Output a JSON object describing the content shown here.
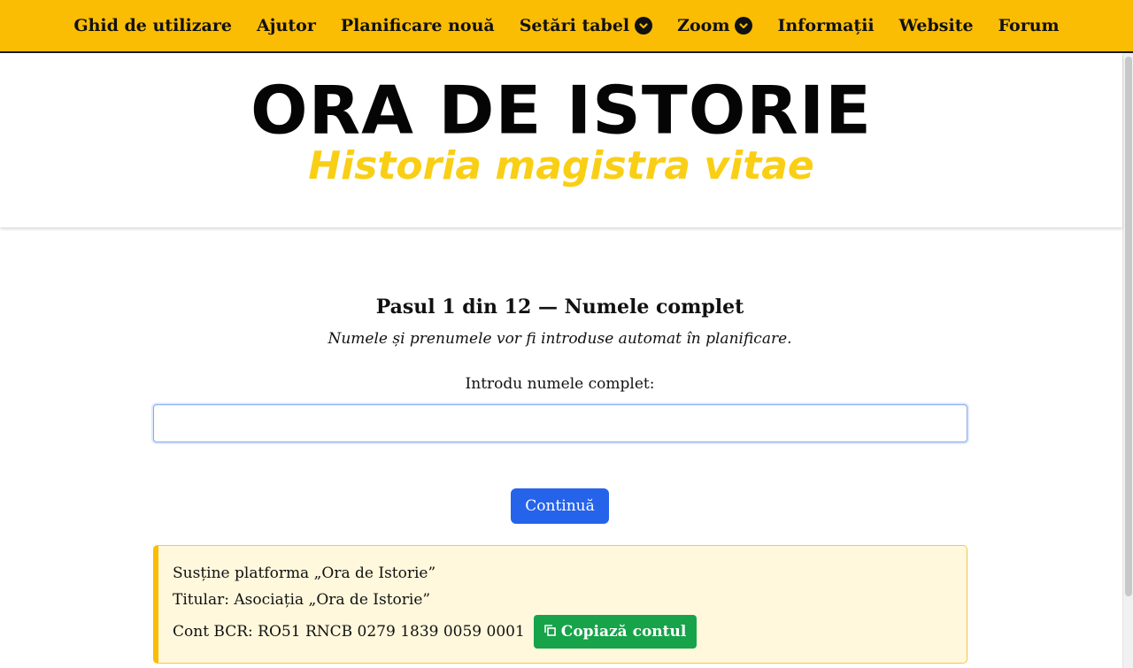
{
  "nav": {
    "items": [
      {
        "label": "Ghid de utilizare",
        "dropdown": false
      },
      {
        "label": "Ajutor",
        "dropdown": false
      },
      {
        "label": "Planificare nouă",
        "dropdown": false
      },
      {
        "label": "Setări tabel",
        "dropdown": true
      },
      {
        "label": "Zoom",
        "dropdown": true
      },
      {
        "label": "Informații",
        "dropdown": false
      },
      {
        "label": "Website",
        "dropdown": false
      },
      {
        "label": "Forum",
        "dropdown": false
      }
    ]
  },
  "header": {
    "title": "ORA DE ISTORIE",
    "subtitle": "Historia magistra vitae"
  },
  "step": {
    "title": "Pasul 1 din 12 — Numele complet",
    "description": "Numele și prenumele vor fi introduse automat în planificare.",
    "field_label": "Introdu numele complet:",
    "input_value": "",
    "continue_label": "Continuă"
  },
  "support": {
    "line1": "Susține platforma „Ora de Istorie”",
    "line2": "Titular: Asociația „Ora de Istorie”",
    "account": "Cont BCR: RO51 RNCB 0279 1839 0059 0001",
    "copy_label": "Copiază contul",
    "copy_icon": "copy-icon"
  },
  "colors": {
    "nav_bg": "#fbbc04",
    "subtitle": "#f9cf16",
    "primary_button": "#2563eb",
    "copy_button": "#16a34a",
    "support_bg": "#fff8dc"
  }
}
